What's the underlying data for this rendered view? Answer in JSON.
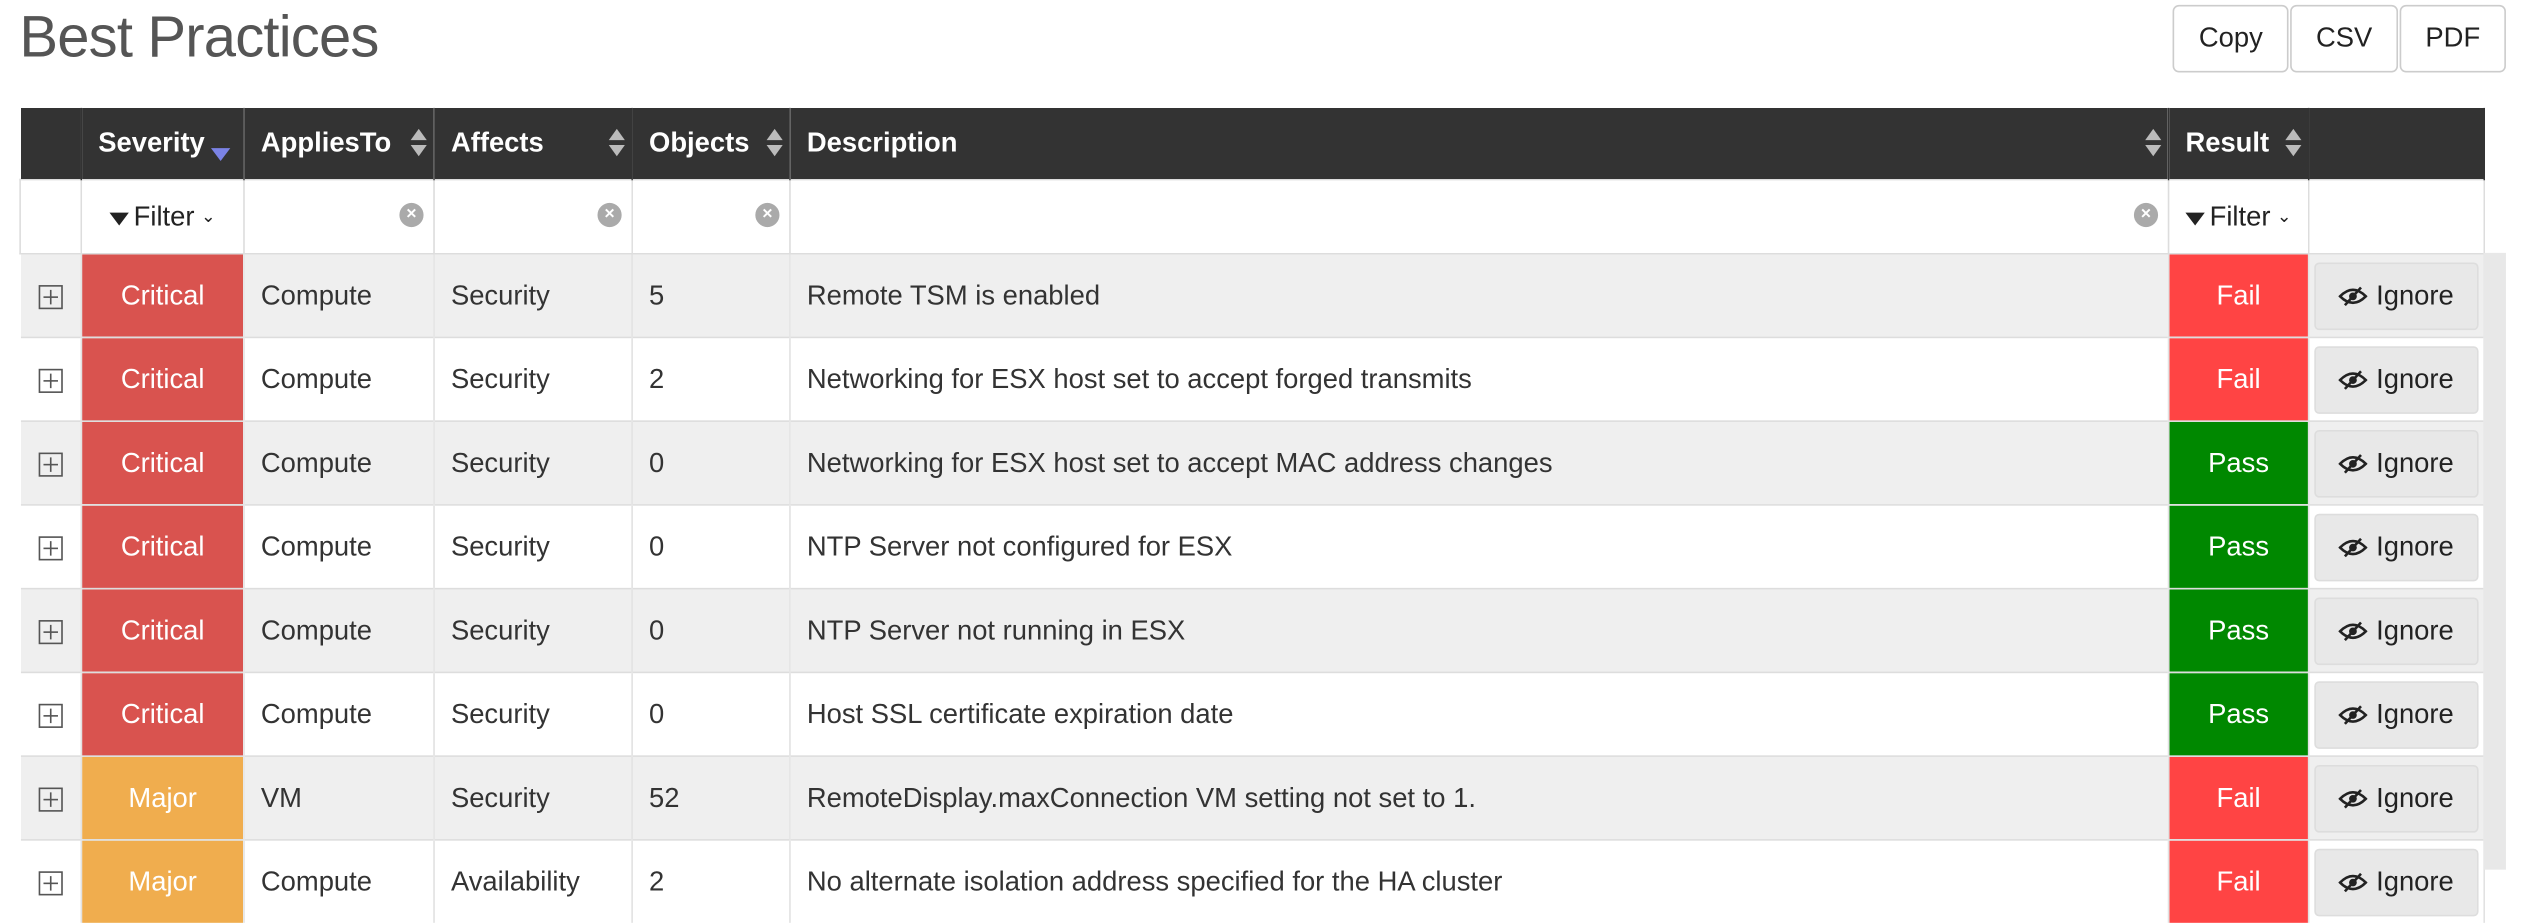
{
  "page": {
    "title": "Best Practices"
  },
  "export": {
    "copy": "Copy",
    "csv": "CSV",
    "pdf": "PDF"
  },
  "columns": {
    "severity": "Severity",
    "applies_to": "AppliesTo",
    "affects": "Affects",
    "objects": "Objects",
    "description": "Description",
    "result": "Result"
  },
  "filters": {
    "severity_label": "Filter",
    "result_label": "Filter",
    "clear_symbol": "×"
  },
  "rows": [
    {
      "severity": "Critical",
      "applies_to": "Compute",
      "affects": "Security",
      "objects": "5",
      "description": "Remote TSM is enabled",
      "result": "Fail",
      "action": "Ignore"
    },
    {
      "severity": "Critical",
      "applies_to": "Compute",
      "affects": "Security",
      "objects": "2",
      "description": "Networking for ESX host set to accept forged transmits",
      "result": "Fail",
      "action": "Ignore"
    },
    {
      "severity": "Critical",
      "applies_to": "Compute",
      "affects": "Security",
      "objects": "0",
      "description": "Networking for ESX host set to accept MAC address changes",
      "result": "Pass",
      "action": "Ignore"
    },
    {
      "severity": "Critical",
      "applies_to": "Compute",
      "affects": "Security",
      "objects": "0",
      "description": "NTP Server not configured for ESX",
      "result": "Pass",
      "action": "Ignore"
    },
    {
      "severity": "Critical",
      "applies_to": "Compute",
      "affects": "Security",
      "objects": "0",
      "description": "NTP Server not running in ESX",
      "result": "Pass",
      "action": "Ignore"
    },
    {
      "severity": "Critical",
      "applies_to": "Compute",
      "affects": "Security",
      "objects": "0",
      "description": "Host SSL certificate expiration date",
      "result": "Pass",
      "action": "Ignore"
    },
    {
      "severity": "Major",
      "applies_to": "VM",
      "affects": "Security",
      "objects": "52",
      "description": "RemoteDisplay.maxConnection VM setting not set to 1.",
      "result": "Fail",
      "action": "Ignore"
    },
    {
      "severity": "Major",
      "applies_to": "Compute",
      "affects": "Availability",
      "objects": "2",
      "description": "No alternate isolation address specified for the HA cluster",
      "result": "Fail",
      "action": "Ignore"
    }
  ],
  "colors": {
    "header_bg": "#333333",
    "critical": "#d9534f",
    "major": "#f0ad4e",
    "fail": "#ff4444",
    "pass": "#008800",
    "sort_active": "#7b83e6"
  },
  "icons": {
    "expand": "plus-square-icon",
    "ignore": "eye-slash-icon",
    "filter": "funnel-icon",
    "clear": "clear-circle-icon"
  }
}
